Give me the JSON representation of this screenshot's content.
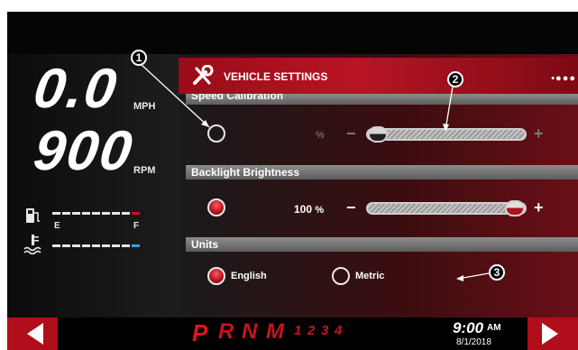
{
  "speedometer": {
    "value": "0.0",
    "unit": "MPH"
  },
  "tachometer": {
    "value": "900",
    "unit": "RPM"
  },
  "fuel": {
    "empty_label": "E",
    "full_label": "F",
    "fill_level": 0.86
  },
  "coolant": {
    "fill_level": 0.86
  },
  "header": {
    "title": "VEHICLE SETTINGS",
    "page_dots": "•●●●"
  },
  "settings": {
    "speed_calibration": {
      "label": "Speed Calibration",
      "value": "",
      "unit": "%",
      "minus": "−",
      "plus": "+",
      "slider_level": 0.0
    },
    "backlight": {
      "label": "Backlight Brightness",
      "value": "100",
      "unit": "%",
      "minus": "−",
      "plus": "+",
      "slider_level": 1.0
    },
    "units": {
      "label": "Units",
      "option_english": "English",
      "option_metric": "Metric",
      "selected": "English"
    }
  },
  "footer": {
    "gears": {
      "p": "P",
      "r": "R",
      "n": "N",
      "m": "M",
      "g1": "1",
      "g2": "2",
      "g3": "3",
      "g4": "4"
    },
    "time": "9:00",
    "ampm": "AM",
    "date": "8/1/2018"
  },
  "callouts": {
    "c1": "1",
    "c2": "2",
    "c3": "3"
  },
  "colors": {
    "accent": "#b81424",
    "background": "#050505",
    "coolant_marker": "#2aa7e0",
    "fuel_marker": "#c4141f"
  }
}
